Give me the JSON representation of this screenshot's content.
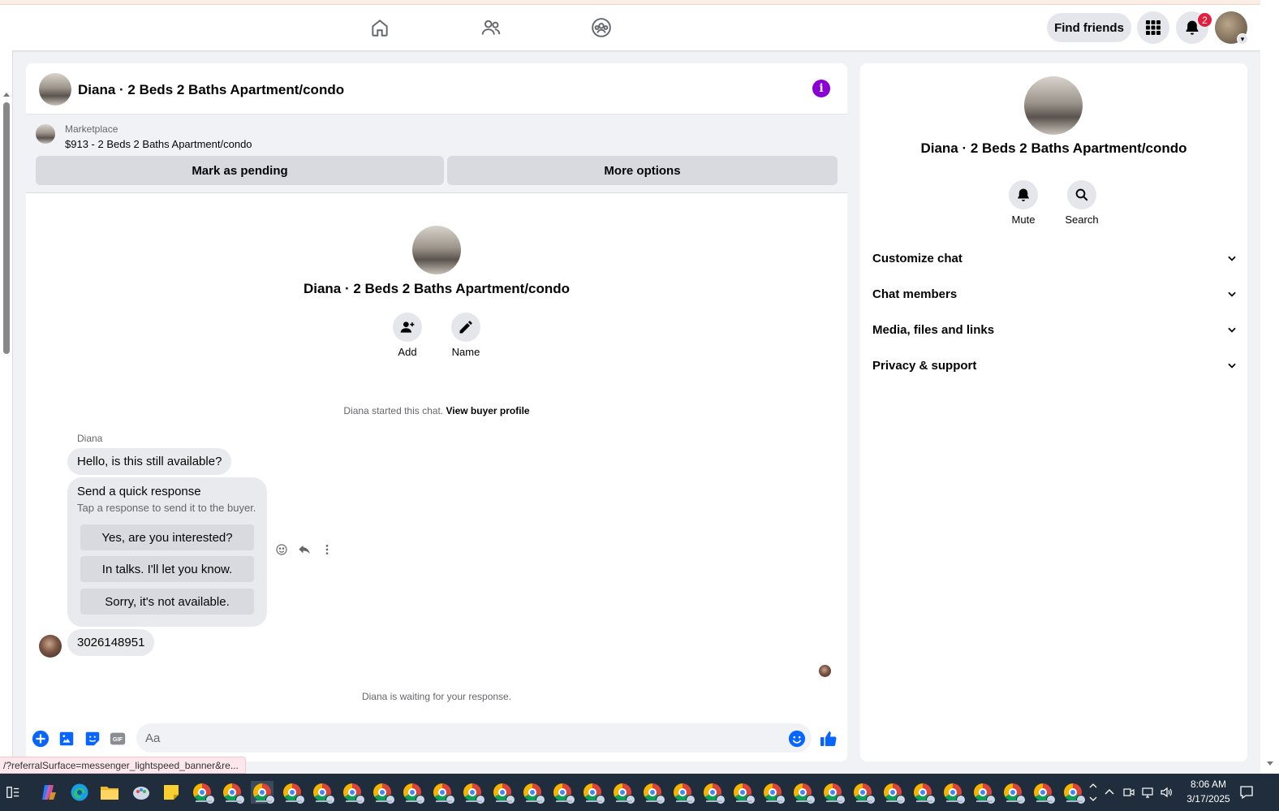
{
  "topnav": {
    "find_friends": "Find friends",
    "notification_count": "2"
  },
  "chat": {
    "title": "Diana · 2 Beds 2 Baths Apartment/condo",
    "marketplace": {
      "label": "Marketplace",
      "listing": "$913 - 2 Beds 2 Baths Apartment/condo",
      "mark_pending": "Mark as pending",
      "more_options": "More options"
    },
    "intro": {
      "title": "Diana · 2 Beds 2 Baths Apartment/condo",
      "add_label": "Add",
      "name_label": "Name"
    },
    "started_text": "Diana started this chat.",
    "view_buyer_profile": "View buyer profile",
    "sender_name": "Diana",
    "message_1": "Hello, is this still available?",
    "quick_response": {
      "title": "Send a quick response",
      "subtitle": "Tap a response to send it to the buyer.",
      "options": [
        "Yes, are you interested?",
        "In talks. I'll let you know.",
        "Sorry, it's not available."
      ]
    },
    "message_2": "3026148951",
    "waiting_text": "Diana is waiting for your response.",
    "composer_placeholder": "Aa"
  },
  "side": {
    "title": "Diana · 2 Beds 2 Baths Apartment/condo",
    "mute_label": "Mute",
    "search_label": "Search",
    "sections": [
      "Customize chat",
      "Chat members",
      "Media, files and links",
      "Privacy & support"
    ]
  },
  "status_url": "/?referralSurface=messenger_lightspeed_banner&re...",
  "taskbar": {
    "time": "8:06 AM",
    "date": "3/17/2025"
  },
  "colors": {
    "accent_blue": "#0866ff",
    "info_purple": "#8a00d4",
    "badge_red": "#e41e3f"
  }
}
